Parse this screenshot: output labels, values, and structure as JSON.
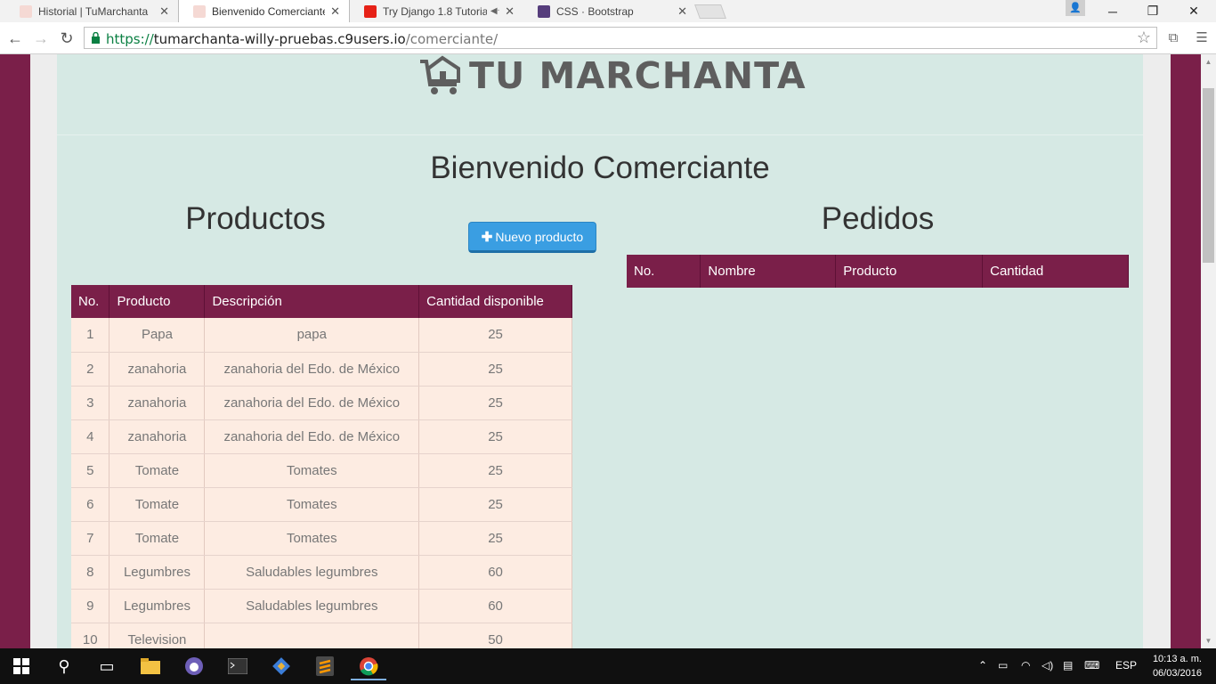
{
  "browser": {
    "tabs": [
      {
        "title": "Historial | TuMarchanta",
        "active": false
      },
      {
        "title": "Bienvenido Comerciante |",
        "active": true
      },
      {
        "title": "Try Django 1.8 Tutorial",
        "active": false
      },
      {
        "title": "CSS · Bootstrap",
        "active": false
      }
    ],
    "url_scheme": "https://",
    "url_host": "tumarchanta-willy-pruebas.c9users.io",
    "url_path": "/comerciante/"
  },
  "page": {
    "brand": "TU MARCHANTA",
    "welcome": "Bienvenido Comerciante",
    "productos_heading": "Productos",
    "pedidos_heading": "Pedidos",
    "new_product_label": "Nuevo producto"
  },
  "productos_table": {
    "headers": [
      "No.",
      "Producto",
      "Descripción",
      "Cantidad disponible"
    ],
    "rows": [
      [
        "1",
        "Papa",
        "papa",
        "25"
      ],
      [
        "2",
        "zanahoria",
        "zanahoria del Edo. de México",
        "25"
      ],
      [
        "3",
        "zanahoria",
        "zanahoria del Edo. de México",
        "25"
      ],
      [
        "4",
        "zanahoria",
        "zanahoria del Edo. de México",
        "25"
      ],
      [
        "5",
        "Tomate",
        "Tomates",
        "25"
      ],
      [
        "6",
        "Tomate",
        "Tomates",
        "25"
      ],
      [
        "7",
        "Tomate",
        "Tomates",
        "25"
      ],
      [
        "8",
        "Legumbres",
        "Saludables legumbres",
        "60"
      ],
      [
        "9",
        "Legumbres",
        "Saludables legumbres",
        "60"
      ],
      [
        "10",
        "Television",
        "",
        "50"
      ]
    ]
  },
  "pedidos_table": {
    "headers": [
      "No.",
      "Nombre",
      "Producto",
      "Cantidad"
    ]
  },
  "taskbar": {
    "language": "ESP",
    "time": "10:13 a. m.",
    "date": "06/03/2016"
  }
}
